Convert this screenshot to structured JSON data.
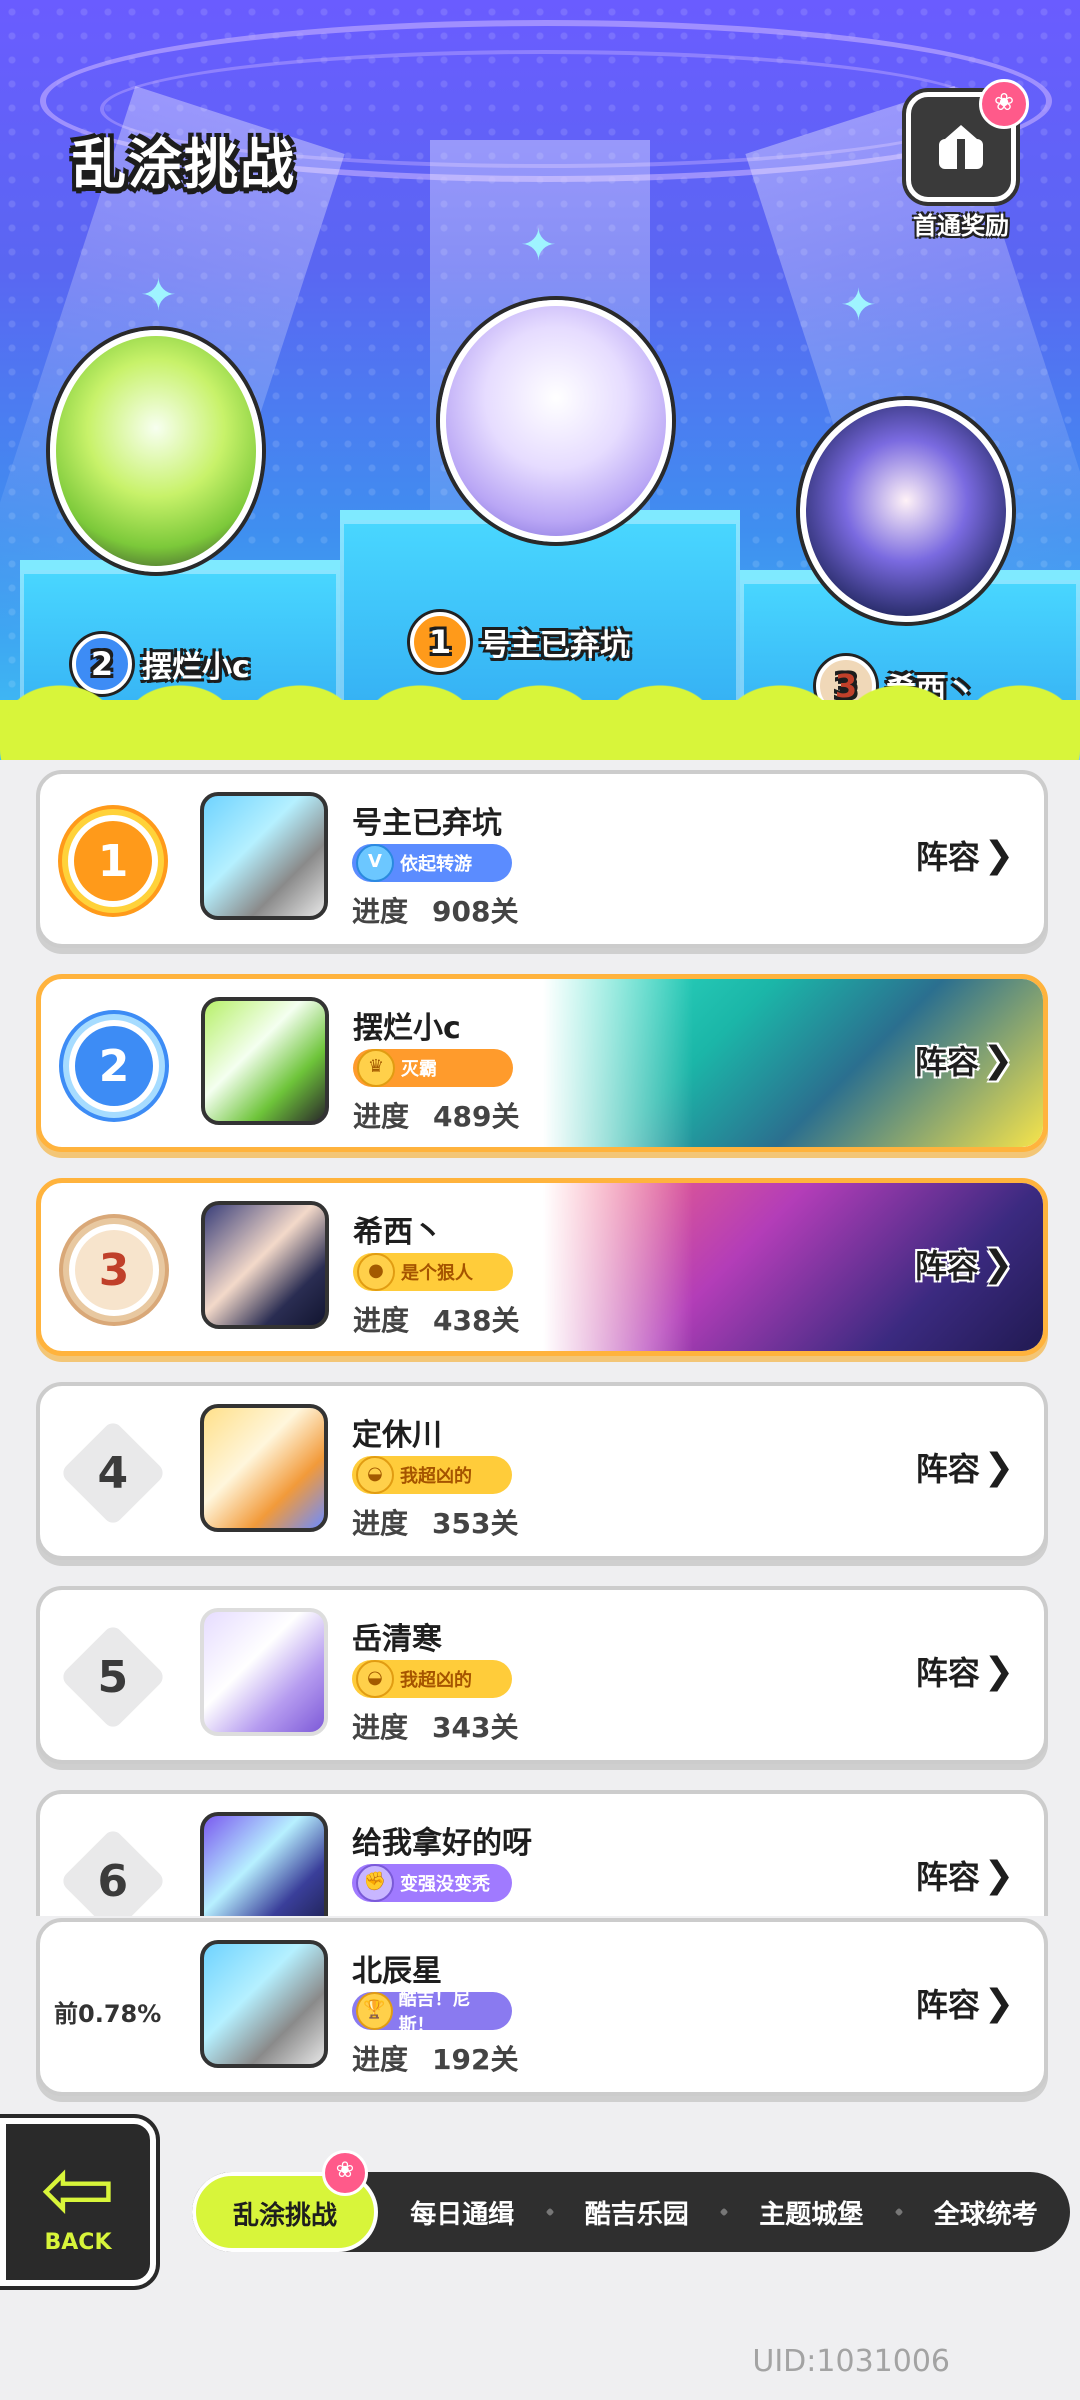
{
  "header": {
    "title": "乱涂挑战",
    "reward_label": "首通奖励",
    "reward_icon": "gift-icon"
  },
  "podium": [
    {
      "rank": "1",
      "name": "号主已弃坑",
      "medal": "gold"
    },
    {
      "rank": "2",
      "name": "摆烂小c",
      "medal": "silver"
    },
    {
      "rank": "3",
      "name": "希西丶",
      "medal": "bronze"
    }
  ],
  "list": {
    "progress_label": "进度",
    "lineup_label": "阵容",
    "rows": [
      {
        "rank": "1",
        "name": "号主已弃坑",
        "tag": "依起转游",
        "progress": "908关",
        "style": "gold"
      },
      {
        "rank": "2",
        "name": "摆烂小c",
        "tag": "灭霸",
        "progress": "489关",
        "style": "silver"
      },
      {
        "rank": "3",
        "name": "希西丶",
        "tag": "是个狠人",
        "progress": "438关",
        "style": "bronze"
      },
      {
        "rank": "4",
        "name": "定休川",
        "tag": "我超凶的",
        "progress": "353关"
      },
      {
        "rank": "5",
        "name": "岳清寒",
        "tag": "我超凶的",
        "progress": "343关"
      },
      {
        "rank": "6",
        "name": "给我拿好的呀",
        "tag": "变强没变秃",
        "progress": ""
      }
    ]
  },
  "self": {
    "percent": "前0.78%",
    "name": "北辰星",
    "tag": "酷吉！尼斯！",
    "progress": "192关"
  },
  "nav": {
    "back_label": "BACK",
    "tabs": [
      "乱涂挑战",
      "每日通缉",
      "酷吉乐园",
      "主题城堡",
      "全球统考"
    ]
  },
  "uid": "UID:1031006",
  "colors": {
    "accent": "#d8f53a",
    "gold": "#ff9a1a",
    "silver": "#3d8cf5",
    "highlight_border": "#ffb33d"
  }
}
